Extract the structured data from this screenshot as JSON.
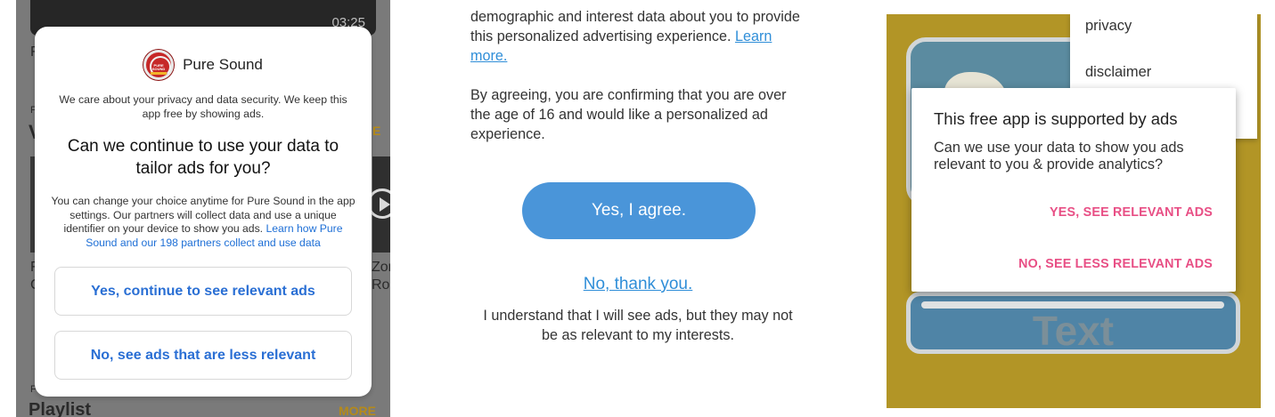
{
  "panel1": {
    "background": {
      "video_duration": "03:25",
      "text_fragments": [
        "F",
        "F",
        "V",
        "F",
        "C",
        "Zor",
        "Roa",
        "F",
        "Playlist"
      ],
      "more_labels": [
        "E",
        "MORE"
      ]
    },
    "dialog": {
      "app_name": "Pure Sound",
      "logo_text": "PURE SOUND",
      "intro": "We care about your privacy and data security. We keep this app free by showing ads.",
      "question": "Can we continue to use your data to tailor ads for you?",
      "detail": "You can change your choice anytime for Pure Sound in the app settings. Our partners will collect data and use a unique identifier on your device to show you ads.",
      "detail_link": "Learn how Pure Sound and our 198 partners collect and use data",
      "accept_label": "Yes, continue to see relevant ads",
      "decline_label": "No, see ads that are less relevant"
    },
    "colors": {
      "accent": "#2a6fd4",
      "link": "#1e6fd6"
    }
  },
  "panel2": {
    "paragraph1": "demographic and interest data about you to provide this personalized advertising experience.",
    "learn_more": "Learn more.",
    "paragraph2": "By agreeing, you are confirming that you are over the age of 16 and would like a personalized ad experience.",
    "agree_label": "Yes, I agree.",
    "decline_link": "No, thank you.",
    "decline_note": "I understand that I will see ads, but they may not be as relevant to my interests.",
    "colors": {
      "accent": "#4a95d9",
      "link": "#2f8ed8"
    }
  },
  "panel3": {
    "menu_items": [
      "privacy",
      "disclaimer"
    ],
    "dialog": {
      "title": "This free app is supported by ads",
      "body": "Can we use your data to show you ads relevant to you & provide analytics?",
      "accept_label": "YES, SEE RELEVANT ADS",
      "decline_label": "NO, SEE LESS RELEVANT ADS"
    },
    "background_word": "Text",
    "colors": {
      "accent": "#e84f85",
      "background": "#b29526"
    }
  }
}
